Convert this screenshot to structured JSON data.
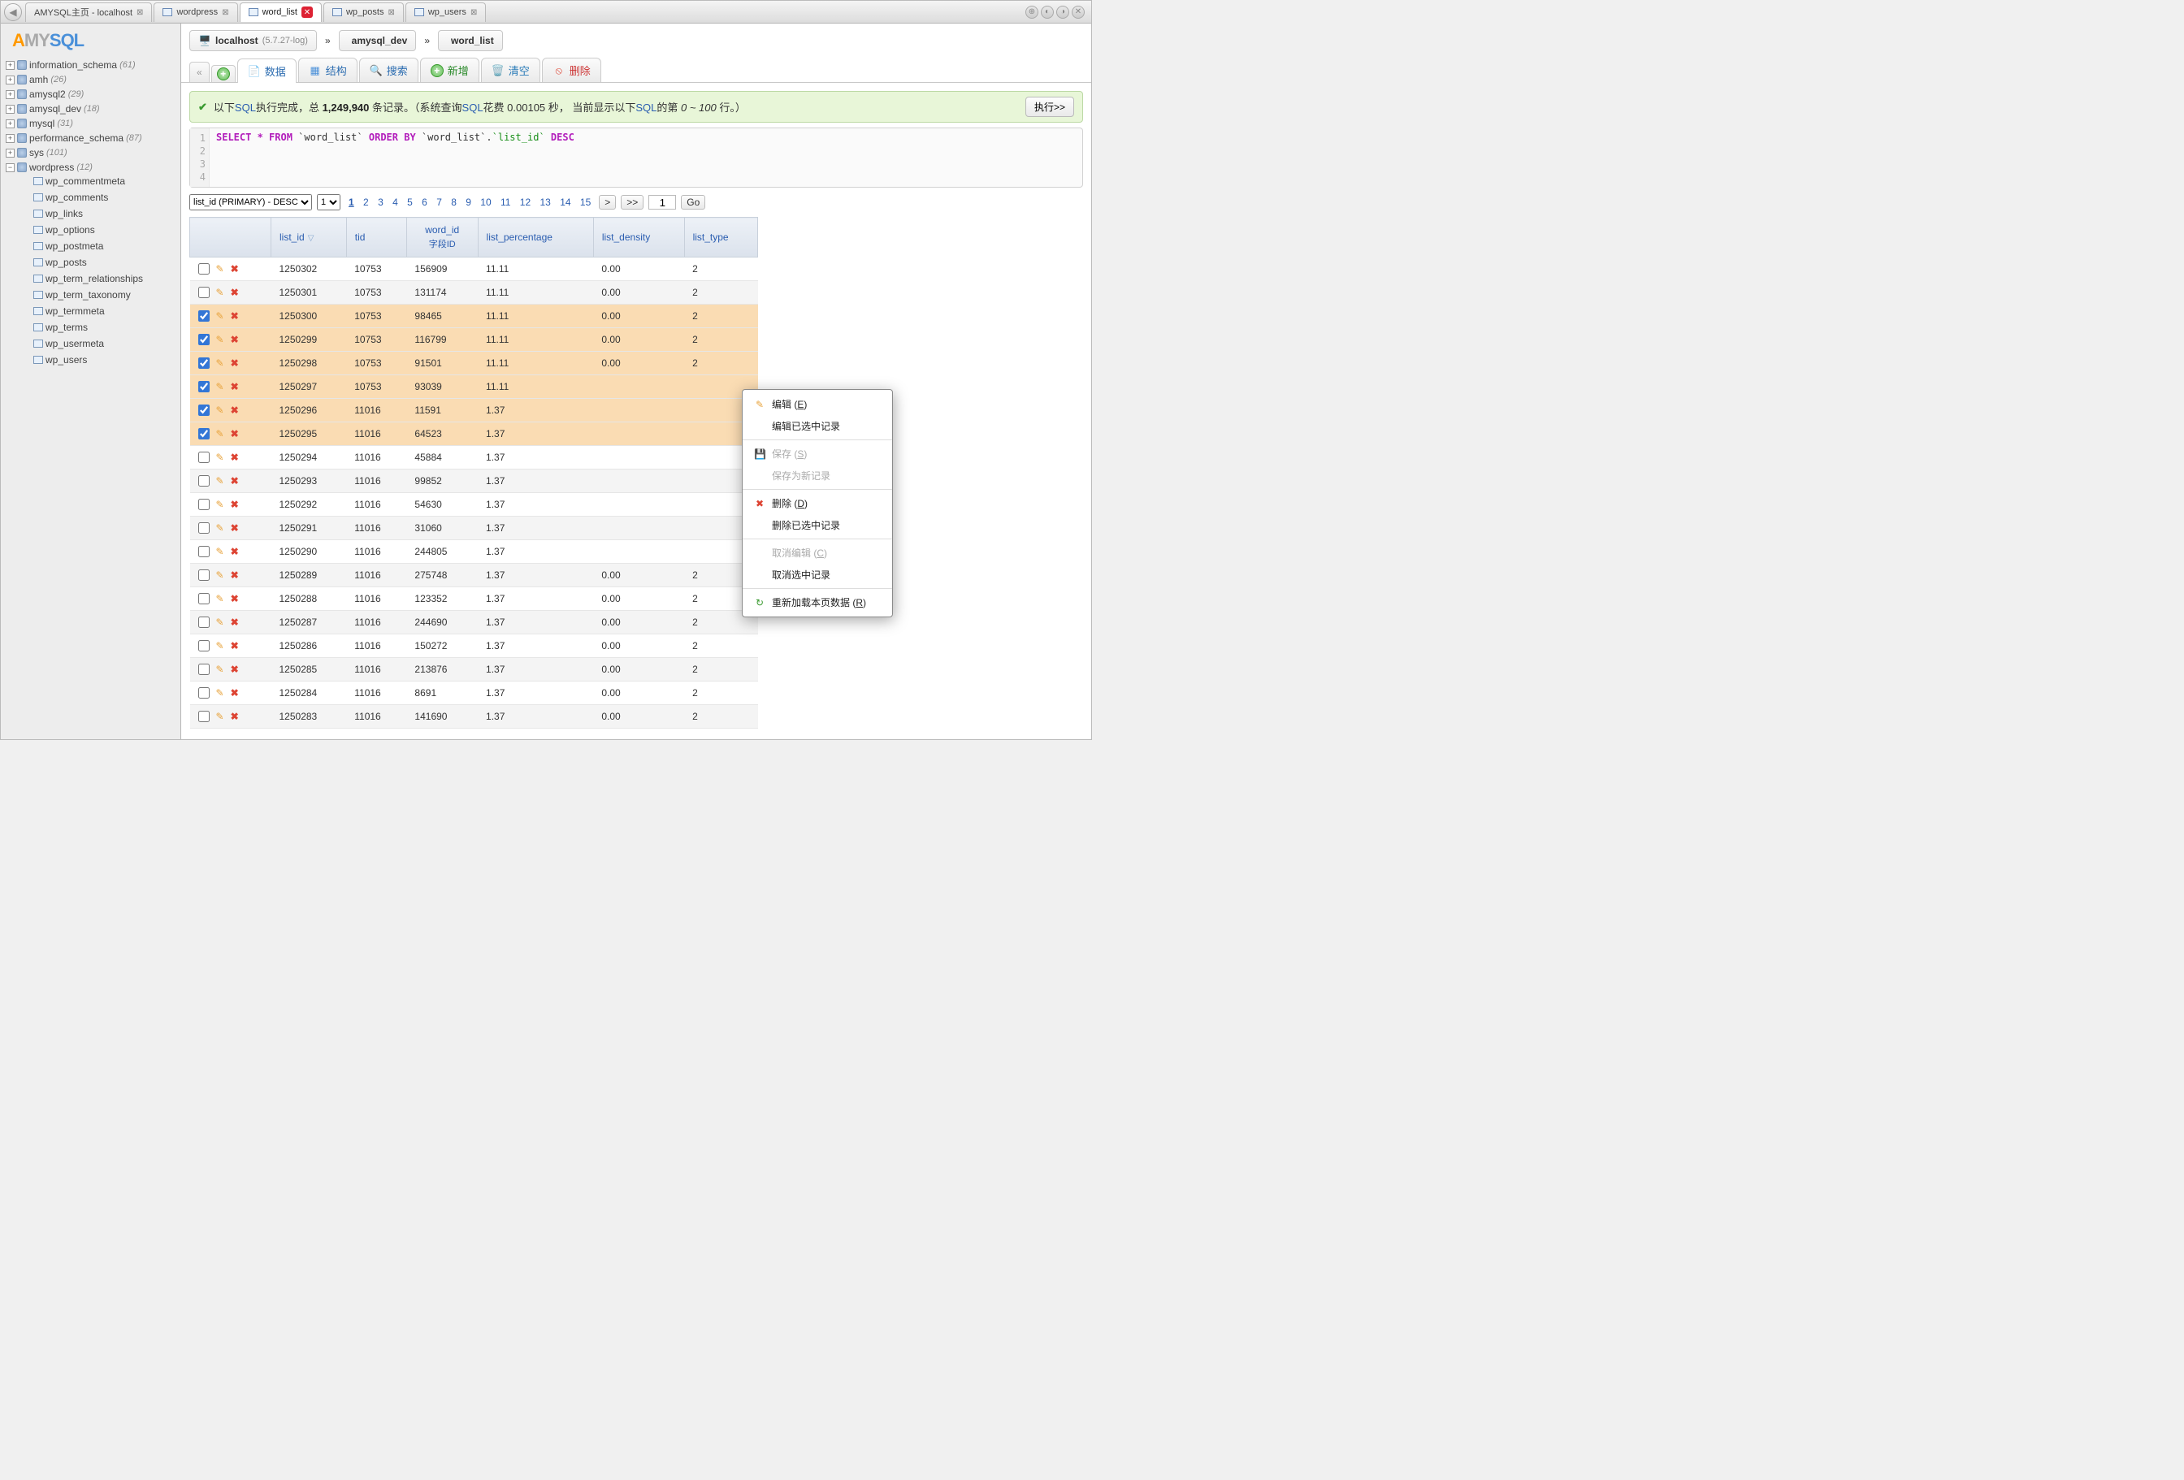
{
  "tabs": {
    "home": "AMYSQL主页 - localhost",
    "items": [
      "wordpress",
      "word_list",
      "wp_posts",
      "wp_users"
    ],
    "active": "word_list"
  },
  "logo": {
    "a": "A",
    "my": "MY",
    "sql": "SQL"
  },
  "databases": [
    {
      "name": "information_schema",
      "count": "(61)",
      "open": false
    },
    {
      "name": "amh",
      "count": "(26)",
      "open": false
    },
    {
      "name": "amysql2",
      "count": "(29)",
      "open": false
    },
    {
      "name": "amysql_dev",
      "count": "(18)",
      "open": false
    },
    {
      "name": "mysql",
      "count": "(31)",
      "open": false
    },
    {
      "name": "performance_schema",
      "count": "(87)",
      "open": false
    },
    {
      "name": "sys",
      "count": "(101)",
      "open": false
    },
    {
      "name": "wordpress",
      "count": "(12)",
      "open": true
    }
  ],
  "wp_tables": [
    "wp_commentmeta",
    "wp_comments",
    "wp_links",
    "wp_options",
    "wp_postmeta",
    "wp_posts",
    "wp_term_relationships",
    "wp_term_taxonomy",
    "wp_termmeta",
    "wp_terms",
    "wp_usermeta",
    "wp_users"
  ],
  "breadcrumb": {
    "host": "localhost",
    "ver": "(5.7.27-log)",
    "db": "amysql_dev",
    "table": "word_list"
  },
  "toolbar": {
    "back": "«",
    "data": "数据",
    "struct": "结构",
    "search": "搜索",
    "new": "新增",
    "clear": "清空",
    "delete": "删除"
  },
  "status": {
    "pre": "以下",
    "sql": "SQL",
    "mid1": "执行完成，总 ",
    "count": "1,249,940",
    "mid2": " 条记录。（系统查询",
    "mid3": "花费 0.00105 秒， 当前显示以下",
    "mid4": "的第 ",
    "range": "0 ~ 100",
    "mid5": " 行。）",
    "run": "执行>>"
  },
  "sql_tokens": {
    "select": "SELECT * FROM",
    "t1": "`word_list`",
    "orderby": "ORDER BY",
    "t2": "`word_list`",
    "dot": ".",
    "c": "`list_id`",
    "desc": "DESC"
  },
  "pager": {
    "sort": "list_id (PRIMARY) - DESC",
    "per": "1",
    "pages": [
      "1",
      "2",
      "3",
      "4",
      "5",
      "6",
      "7",
      "8",
      "9",
      "10",
      "11",
      "12",
      "13",
      "14",
      "15"
    ],
    "next": ">",
    "jump": ">>",
    "goval": "1",
    "go": "Go"
  },
  "columns": {
    "actions": "Edit/Delete",
    "list_id": "list_id",
    "tid": "tid",
    "word_id": "word_id",
    "word_id_sub": "字段ID",
    "list_percentage": "list_percentage",
    "list_density": "list_density",
    "list_type": "list_type"
  },
  "rows": [
    {
      "sel": false,
      "id": "1250302",
      "tid": "10753",
      "wid": "156909",
      "pct": "11.11",
      "den": "0.00",
      "type": "2"
    },
    {
      "sel": false,
      "id": "1250301",
      "tid": "10753",
      "wid": "131174",
      "pct": "11.11",
      "den": "0.00",
      "type": "2"
    },
    {
      "sel": true,
      "id": "1250300",
      "tid": "10753",
      "wid": "98465",
      "pct": "11.11",
      "den": "0.00",
      "type": "2"
    },
    {
      "sel": true,
      "id": "1250299",
      "tid": "10753",
      "wid": "116799",
      "pct": "11.11",
      "den": "0.00",
      "type": "2"
    },
    {
      "sel": true,
      "id": "1250298",
      "tid": "10753",
      "wid": "91501",
      "pct": "11.11",
      "den": "0.00",
      "type": "2"
    },
    {
      "sel": true,
      "id": "1250297",
      "tid": "10753",
      "wid": "93039",
      "pct": "11.11",
      "den": "",
      "type": ""
    },
    {
      "sel": true,
      "id": "1250296",
      "tid": "11016",
      "wid": "11591",
      "pct": "1.37",
      "den": "",
      "type": ""
    },
    {
      "sel": true,
      "id": "1250295",
      "tid": "11016",
      "wid": "64523",
      "pct": "1.37",
      "den": "",
      "type": ""
    },
    {
      "sel": false,
      "id": "1250294",
      "tid": "11016",
      "wid": "45884",
      "pct": "1.37",
      "den": "",
      "type": ""
    },
    {
      "sel": false,
      "id": "1250293",
      "tid": "11016",
      "wid": "99852",
      "pct": "1.37",
      "den": "",
      "type": ""
    },
    {
      "sel": false,
      "id": "1250292",
      "tid": "11016",
      "wid": "54630",
      "pct": "1.37",
      "den": "",
      "type": ""
    },
    {
      "sel": false,
      "id": "1250291",
      "tid": "11016",
      "wid": "31060",
      "pct": "1.37",
      "den": "",
      "type": ""
    },
    {
      "sel": false,
      "id": "1250290",
      "tid": "11016",
      "wid": "244805",
      "pct": "1.37",
      "den": "",
      "type": ""
    },
    {
      "sel": false,
      "id": "1250289",
      "tid": "11016",
      "wid": "275748",
      "pct": "1.37",
      "den": "0.00",
      "type": "2"
    },
    {
      "sel": false,
      "id": "1250288",
      "tid": "11016",
      "wid": "123352",
      "pct": "1.37",
      "den": "0.00",
      "type": "2"
    },
    {
      "sel": false,
      "id": "1250287",
      "tid": "11016",
      "wid": "244690",
      "pct": "1.37",
      "den": "0.00",
      "type": "2"
    },
    {
      "sel": false,
      "id": "1250286",
      "tid": "11016",
      "wid": "150272",
      "pct": "1.37",
      "den": "0.00",
      "type": "2"
    },
    {
      "sel": false,
      "id": "1250285",
      "tid": "11016",
      "wid": "213876",
      "pct": "1.37",
      "den": "0.00",
      "type": "2"
    },
    {
      "sel": false,
      "id": "1250284",
      "tid": "11016",
      "wid": "8691",
      "pct": "1.37",
      "den": "0.00",
      "type": "2"
    },
    {
      "sel": false,
      "id": "1250283",
      "tid": "11016",
      "wid": "141690",
      "pct": "1.37",
      "den": "0.00",
      "type": "2"
    }
  ],
  "ctx": {
    "edit": "编辑",
    "edit_k": "E",
    "edit_sel": "编辑已选中记录",
    "save": "保存",
    "save_k": "S",
    "save_as": "保存为新记录",
    "del": "删除",
    "del_k": "D",
    "del_sel": "删除已选中记录",
    "cancel_edit": "取消编辑",
    "cancel_k": "C",
    "cancel_sel": "取消选中记录",
    "reload": "重新加载本页数据",
    "reload_k": "R"
  }
}
